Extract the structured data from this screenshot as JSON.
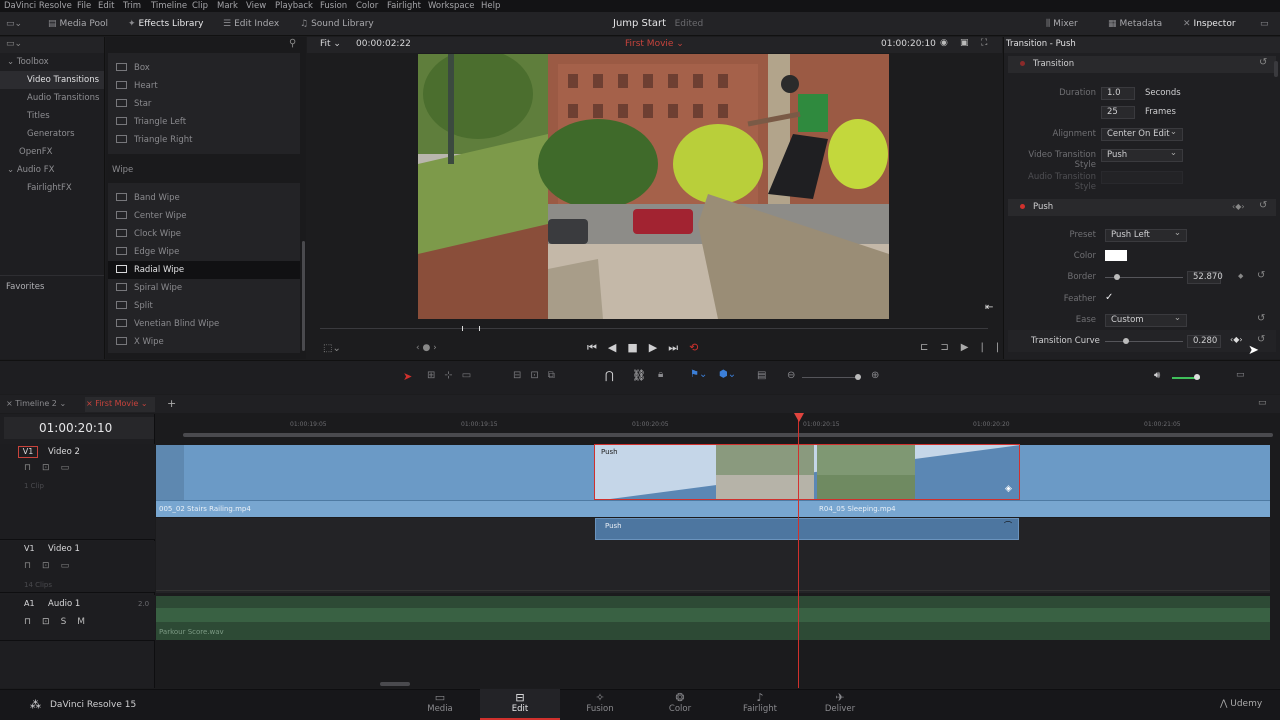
{
  "menubar": {
    "items": [
      "DaVinci Resolve",
      "File",
      "Edit",
      "Trim",
      "Timeline",
      "Clip",
      "Mark",
      "View",
      "Playback",
      "Fusion",
      "Color",
      "Fairlight",
      "Workspace",
      "Help"
    ]
  },
  "toolbar": {
    "media_pool": "Media Pool",
    "effects_library": "Effects Library",
    "edit_index": "Edit Index",
    "sound_library": "Sound Library",
    "project_title": "Jump Start",
    "project_status": "Edited",
    "mixer": "Mixer",
    "metadata": "Metadata",
    "inspector": "Inspector"
  },
  "toolbox": {
    "items": [
      {
        "label": "Toolbox",
        "indent": 0,
        "sel": false,
        "arrow": true
      },
      {
        "label": "Video Transitions",
        "indent": 1,
        "sel": true
      },
      {
        "label": "Audio Transitions",
        "indent": 1
      },
      {
        "label": "Titles",
        "indent": 1
      },
      {
        "label": "Generators",
        "indent": 1
      },
      {
        "label": "OpenFX",
        "indent": 0
      },
      {
        "label": "Audio FX",
        "indent": 0,
        "arrow": true
      },
      {
        "label": "FairlightFX",
        "indent": 1
      }
    ],
    "favorites": "Favorites"
  },
  "effects": {
    "top_items": [
      "Box",
      "Heart",
      "Star",
      "Triangle Left",
      "Triangle Right"
    ],
    "wipe_header": "Wipe",
    "wipe_items": [
      "Band Wipe",
      "Center Wipe",
      "Clock Wipe",
      "Edge Wipe",
      "Radial Wipe",
      "Spiral Wipe",
      "Split",
      "Venetian Blind Wipe",
      "X Wipe"
    ],
    "selected": "Radial Wipe"
  },
  "viewer": {
    "zoom": "Fit",
    "source_tc": "00:00:02:22",
    "timeline_name": "First Movie",
    "record_tc": "01:00:20:10"
  },
  "inspector": {
    "title": "Transition - Push",
    "section_transition": "Transition",
    "duration_label": "Duration",
    "duration_value": "1.0",
    "duration_unit": "Seconds",
    "frames_value": "25",
    "frames_unit": "Frames",
    "alignment_label": "Alignment",
    "alignment_value": "Center On Edit",
    "vts_label": "Video Transition Style",
    "vts_value": "Push",
    "ats_label": "Audio Transition Style",
    "section_push": "Push",
    "preset_label": "Preset",
    "preset_value": "Push Left",
    "color_label": "Color",
    "border_label": "Border",
    "border_value": "52.870",
    "feather_label": "Feather",
    "ease_label": "Ease",
    "ease_value": "Custom",
    "curve_label": "Transition Curve",
    "curve_value": "0.280"
  },
  "timeline": {
    "tabs": [
      "Timeline 2",
      "First Movie"
    ],
    "timecode": "01:00:20:10",
    "ruler": [
      "01:00:19:05",
      "01:00:19:15",
      "01:00:20:05",
      "01:00:20:15",
      "01:00:20:20",
      "01:00:21:05"
    ],
    "tracks": [
      {
        "id": "V1",
        "name": "Video 2",
        "clips": "1 Clip"
      },
      {
        "id": "V1",
        "name": "Video 1",
        "clips": "14 Clips"
      },
      {
        "id": "A1",
        "name": "Audio 1",
        "level": "2.0"
      }
    ],
    "clip_left": "005_02 Stairs Railing.mp4",
    "clip_right": "R04_05 Sleeping.mp4",
    "transition_label": "Push",
    "audio_clip": "Parkour Score.wav"
  },
  "pages": {
    "items": [
      "Media",
      "Edit",
      "Fusion",
      "Color",
      "Fairlight",
      "Deliver"
    ],
    "active": "Edit"
  },
  "app": {
    "name": "DaVinci Resolve 15",
    "watermark": "Udemy"
  },
  "colors": {
    "accent": "#d0312d",
    "clip_blue": "#6b9ac6",
    "audio_green": "#2d4a35"
  }
}
